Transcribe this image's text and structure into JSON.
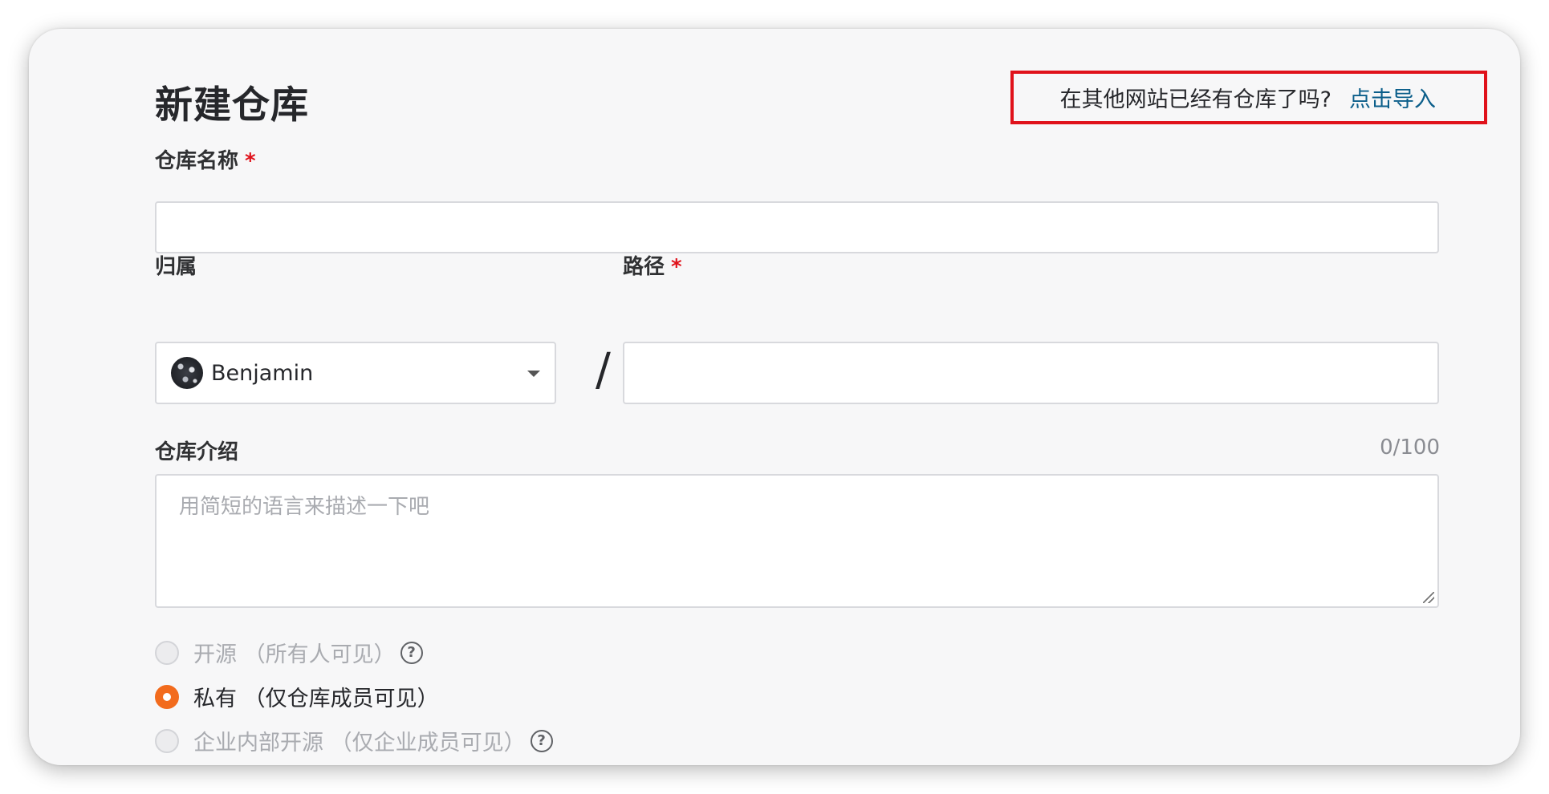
{
  "header": {
    "title": "新建仓库",
    "import_question": "在其他网站已经有仓库了吗?",
    "import_link": "点击导入"
  },
  "form": {
    "repo_name": {
      "label": "仓库名称",
      "required_mark": "*",
      "value": ""
    },
    "owner": {
      "label": "归属",
      "value": "Benjamin",
      "icon": "chevron-down-icon"
    },
    "separator": "/",
    "path": {
      "label": "路径",
      "required_mark": "*",
      "value": ""
    },
    "description": {
      "label": "仓库介绍",
      "counter": "0/100",
      "placeholder": "用简短的语言来描述一下吧"
    },
    "visibility": {
      "options": [
        {
          "label": "开源 （所有人可见）",
          "state": "disabled",
          "has_help": true
        },
        {
          "label": "私有 （仅仓库成员可见）",
          "state": "checked",
          "has_help": false
        },
        {
          "label": "企业内部开源 （仅企业成员可见）",
          "state": "disabled",
          "has_help": true
        }
      ],
      "help_glyph": "?"
    }
  },
  "colors": {
    "accent_orange": "#f26b1d",
    "link_blue": "#0b5e8a",
    "highlight_red": "#e0121b",
    "required_red": "#e0121b"
  }
}
